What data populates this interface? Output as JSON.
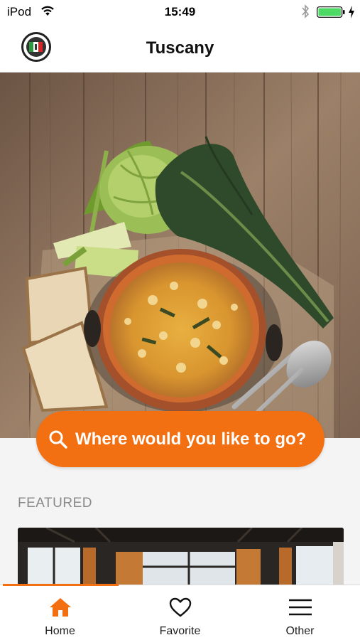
{
  "status_bar": {
    "carrier": "iPod",
    "time": "15:49"
  },
  "nav": {
    "title": "Tuscany"
  },
  "search": {
    "label": "Where would you like to go?"
  },
  "featured": {
    "header": "FEATURED"
  },
  "tabs": [
    {
      "label": "Home",
      "icon": "home-icon",
      "active": true
    },
    {
      "label": "Favorite",
      "icon": "heart-icon",
      "active": false
    },
    {
      "label": "Other",
      "icon": "menu-icon",
      "active": false
    }
  ],
  "colors": {
    "accent": "#f26f12",
    "battery": "#4cd964"
  }
}
